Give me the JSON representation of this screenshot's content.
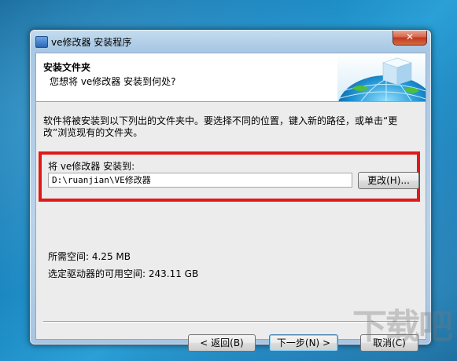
{
  "window": {
    "title": "ve修改器 安装程序",
    "close_label": "✕"
  },
  "header": {
    "title": "安装文件夹",
    "subtitle": "您想将 ve修改器 安装到何处?"
  },
  "main": {
    "intro_text": "软件将被安装到以下列出的文件夹中。要选择不同的位置，键入新的路径，或单击“更改”浏览现有的文件夹。",
    "install_label": "将 ve修改器 安装到:",
    "install_path": "D:\\ruanjian\\VE修改器",
    "change_button": "更改(H)...",
    "space_required": "所需空间: 4.25 MB",
    "space_available": "选定驱动器的可用空间: 243.11 GB"
  },
  "footer": {
    "back_button": "< 返回(B)",
    "next_button": "下一步(N) >",
    "cancel_button": "取消(C)"
  },
  "colors": {
    "highlight_border": "#e01919",
    "desktop": "#1b86c0"
  },
  "watermark": "下载吧"
}
